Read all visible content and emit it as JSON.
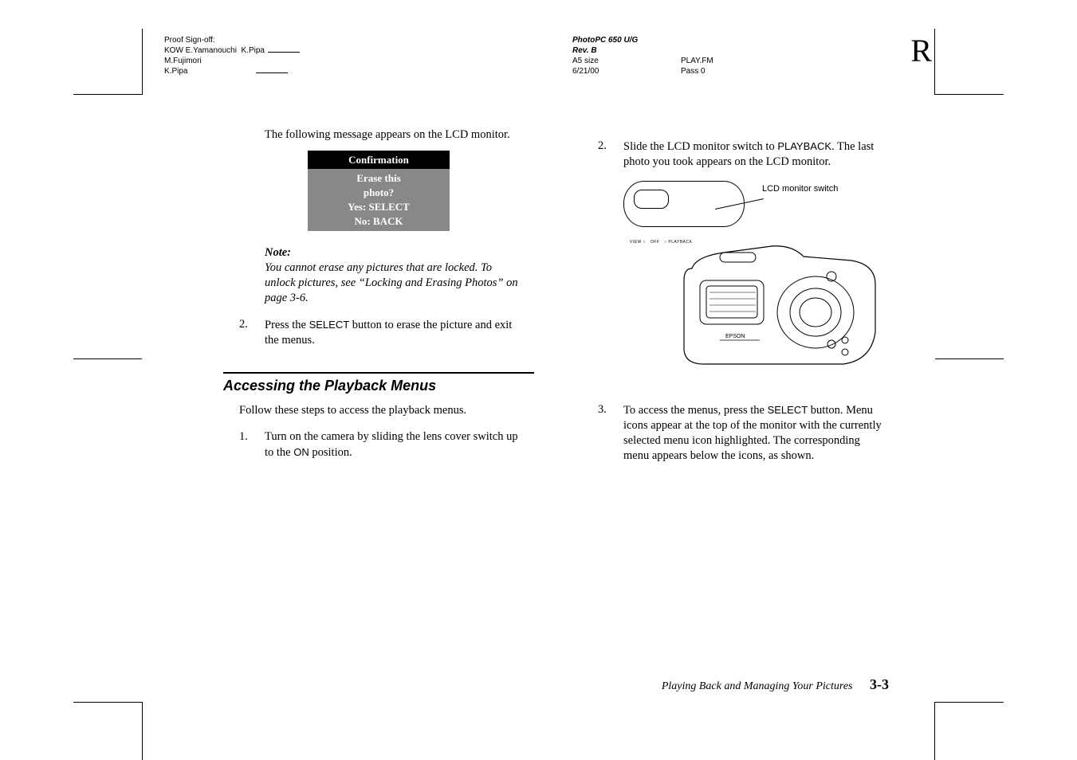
{
  "header_left": {
    "l1": "Proof Sign-off:",
    "l2a": "KOW E.Yamanouchi",
    "l2b": "K.Pipa",
    "l3": "M.Fujimori",
    "l4": "K.Pipa"
  },
  "header_right": {
    "title": "PhotoPC 650 U/G",
    "rev": "Rev. B",
    "size": "A5 size",
    "file": "PLAY.FM",
    "date": "6/21/00",
    "pass": "Pass 0"
  },
  "bigR": "R",
  "left_col": {
    "intro": "The following message appears on the LCD monitor.",
    "confirm": {
      "title": "Confirmation",
      "l1": "Erase this",
      "l2": "photo?",
      "l3": "Yes: SELECT",
      "l4": "No: BACK"
    },
    "note_h": "Note:",
    "note_b": "You cannot erase any pictures that are locked. To unlock pictures, see “Locking and Erasing Photos” on page 3-6.",
    "step2_n": "2.",
    "step2_a": "Press the ",
    "step2_b": "SELECT",
    "step2_c": " button to erase the picture and exit the menus.",
    "h2": "Accessing the Playback Menus",
    "p1": "Follow these steps to access the playback menus.",
    "s1_n": "1.",
    "s1_a": "Turn on the camera by sliding the lens cover switch up to the ",
    "s1_b": "ON",
    "s1_c": " position."
  },
  "right_col": {
    "s2_n": "2.",
    "s2_a": "Slide the LCD monitor switch to ",
    "s2_b": "PLAYBACK",
    "s2_c": ". The last photo you took appears on the LCD monitor.",
    "callout": "LCD monitor switch",
    "switch_text": "VIEW ○   OFF   ○ PLAYBACK",
    "s3_n": "3.",
    "s3_a": "To access the menus, press the ",
    "s3_b": "SELECT",
    "s3_c": " button. Menu icons appear at the top of the monitor with the currently selected menu icon highlighted. The corresponding menu appears below the icons, as shown."
  },
  "footer": {
    "title": "Playing Back and Managing Your Pictures",
    "page": "3-3"
  }
}
